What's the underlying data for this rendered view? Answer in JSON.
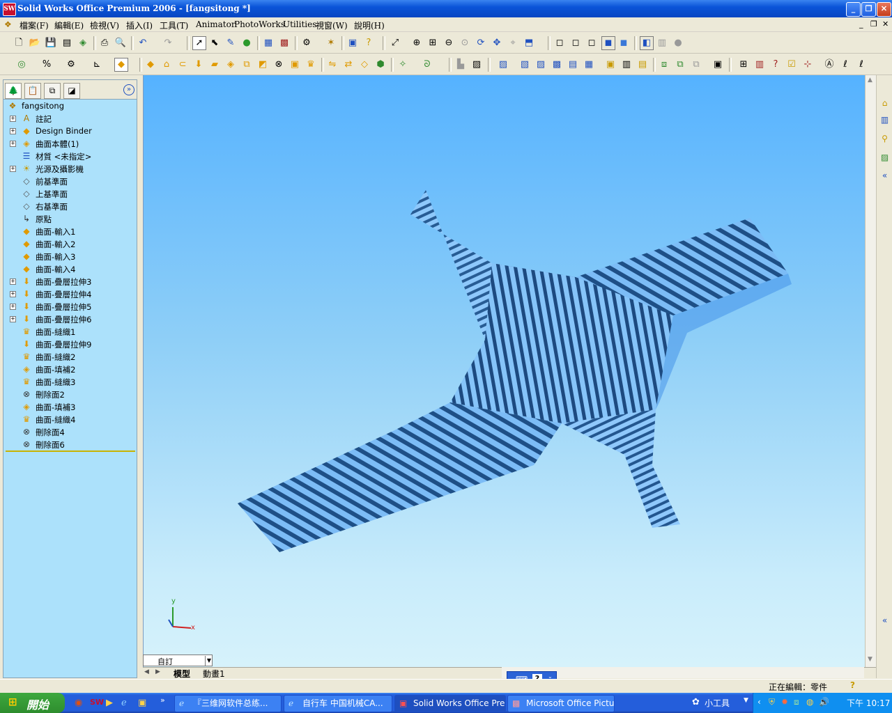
{
  "window": {
    "title": "Solid Works Office Premium 2006 - [fangsitong *]",
    "app_icon": "SW",
    "minimize": "_",
    "maximize": "❐",
    "close": "✕"
  },
  "menu": {
    "items": [
      "檔案(F)",
      "編輯(E)",
      "檢視(V)",
      "插入(I)",
      "工具(T)",
      "Animator",
      "PhotoWorks",
      "Utilities",
      "視窗(W)",
      "說明(H)"
    ],
    "doc_controls": [
      "_",
      "❐",
      "✕"
    ]
  },
  "feature_tree": {
    "root": "fangsitong",
    "items": [
      {
        "label": "註記",
        "icon": "annotations-icon",
        "expandable": true
      },
      {
        "label": "Design Binder",
        "icon": "design-binder-icon",
        "expandable": true
      },
      {
        "label": "曲面本體(1)",
        "icon": "surface-bodies-icon",
        "expandable": true
      },
      {
        "label": "材質 <未指定>",
        "icon": "material-icon",
        "expandable": false
      },
      {
        "label": "光源及攝影機",
        "icon": "lights-cameras-icon",
        "expandable": true
      },
      {
        "label": "前基準面",
        "icon": "plane-icon",
        "expandable": false
      },
      {
        "label": "上基準面",
        "icon": "plane-icon",
        "expandable": false
      },
      {
        "label": "右基準面",
        "icon": "plane-icon",
        "expandable": false
      },
      {
        "label": "原點",
        "icon": "origin-icon",
        "expandable": false
      },
      {
        "label": "曲面-輸入1",
        "icon": "imported-surface-icon",
        "expandable": false
      },
      {
        "label": "曲面-輸入2",
        "icon": "imported-surface-icon",
        "expandable": false
      },
      {
        "label": "曲面-輸入3",
        "icon": "imported-surface-icon",
        "expandable": false
      },
      {
        "label": "曲面-輸入4",
        "icon": "imported-surface-icon",
        "expandable": false
      },
      {
        "label": "曲面-疊層拉伸3",
        "icon": "loft-icon",
        "expandable": true
      },
      {
        "label": "曲面-疊層拉伸4",
        "icon": "loft-icon",
        "expandable": true
      },
      {
        "label": "曲面-疊層拉伸5",
        "icon": "loft-icon",
        "expandable": true
      },
      {
        "label": "曲面-疊層拉伸6",
        "icon": "loft-icon",
        "expandable": true
      },
      {
        "label": "曲面-縫織1",
        "icon": "knit-icon",
        "expandable": false
      },
      {
        "label": "曲面-疊層拉伸9",
        "icon": "loft-icon",
        "expandable": false
      },
      {
        "label": "曲面-縫織2",
        "icon": "knit-icon",
        "expandable": false
      },
      {
        "label": "曲面-填補2",
        "icon": "fill-icon",
        "expandable": false
      },
      {
        "label": "曲面-縫織3",
        "icon": "knit-icon",
        "expandable": false
      },
      {
        "label": "刪除面2",
        "icon": "delete-face-icon",
        "expandable": false
      },
      {
        "label": "曲面-填補3",
        "icon": "fill-icon",
        "expandable": false
      },
      {
        "label": "曲面-縫織4",
        "icon": "knit-icon",
        "expandable": false
      },
      {
        "label": "刪除面4",
        "icon": "delete-face-icon",
        "expandable": false
      },
      {
        "label": "刪除面6",
        "icon": "delete-face-icon",
        "expandable": false
      }
    ]
  },
  "viewport": {
    "axis_x": "x",
    "axis_y": "y",
    "view_combo": "自訂",
    "tabs": [
      "模型",
      "動畫1"
    ]
  },
  "status": {
    "editing": "正在編輯：零件",
    "help": "?"
  },
  "taskbar": {
    "start": "開始",
    "tasks": [
      {
        "label": "『三维网软件总练...",
        "icon": "ie-icon",
        "active": false
      },
      {
        "label": "自行车 中国机械CA...",
        "icon": "ie-icon",
        "active": false
      },
      {
        "label": "Solid Works Office Pre...",
        "icon": "solidworks-icon",
        "active": true
      },
      {
        "label": "Microsoft Office Pictur...",
        "icon": "office-picture-icon",
        "active": false
      }
    ],
    "tray_label": "小工具",
    "clock": "下午 10:17"
  }
}
